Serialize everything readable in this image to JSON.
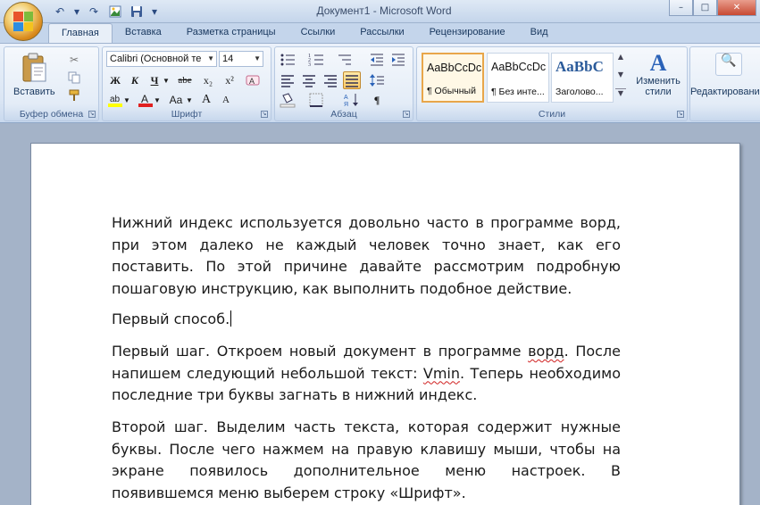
{
  "window": {
    "title": "Документ1 - Microsoft Word",
    "controls": {
      "minimize": "–",
      "maximize": "□",
      "close": "✕"
    }
  },
  "quick_access": {
    "icons": [
      "undo-icon",
      "redo-icon",
      "picture-icon",
      "save-icon",
      "customize-icon"
    ],
    "glyphs": {
      "undo": "↶",
      "redo": "↷",
      "dropdown": "▾"
    }
  },
  "tabs": [
    {
      "label": "Главная",
      "active": true
    },
    {
      "label": "Вставка"
    },
    {
      "label": "Разметка страницы"
    },
    {
      "label": "Ссылки"
    },
    {
      "label": "Рассылки"
    },
    {
      "label": "Рецензирование"
    },
    {
      "label": "Вид"
    }
  ],
  "ribbon": {
    "clipboard": {
      "label": "Буфер обмена",
      "paste_label": "Вставить"
    },
    "font": {
      "label": "Шрифт",
      "font_name": "Calibri (Основной те",
      "font_size": "14",
      "bold": "Ж",
      "italic": "К",
      "underline": "Ч",
      "strike": "abe",
      "subscript": "x₂",
      "superscript": "x²",
      "change_case": "Aa",
      "grow": "A",
      "shrink": "A"
    },
    "paragraph": {
      "label": "Абзац",
      "pilcrow": "¶"
    },
    "styles": {
      "label": "Стили",
      "items": [
        {
          "sample": "AaBbCcDc",
          "name": "¶ Обычный",
          "active": true
        },
        {
          "sample": "AaBbCcDc",
          "name": "¶ Без инте..."
        },
        {
          "sample": "AaBbC",
          "name": "Заголово..."
        }
      ],
      "change_styles_line1": "Изменить",
      "change_styles_line2": "стили"
    },
    "editing": {
      "label": "Редактировани"
    }
  },
  "document": {
    "p1": "Нижний индекс используется довольно часто в программе ворд, при этом далеко не каждый человек точно знает, как его поставить. По этой причине давайте рассмотрим подробную пошаговую инструкцию, как выполнить подобное действие.",
    "p2": "Первый способ.",
    "p3a": "Первый шаг. Откроем новый документ в программе ",
    "p3_word": "ворд",
    "p3b": ". После напишем следующий небольшой текст: ",
    "p3_vmin": "Vmin",
    "p3c": ". Теперь необходимо последние три буквы загнать в нижний индекс.",
    "p4": "Второй шаг. Выделим часть текста, которая содержит нужные буквы. После чего нажмем на правую клавишу мыши, чтобы на экране появилось дополнительное меню настроек. В появившемся меню выберем строку «Шрифт»."
  }
}
